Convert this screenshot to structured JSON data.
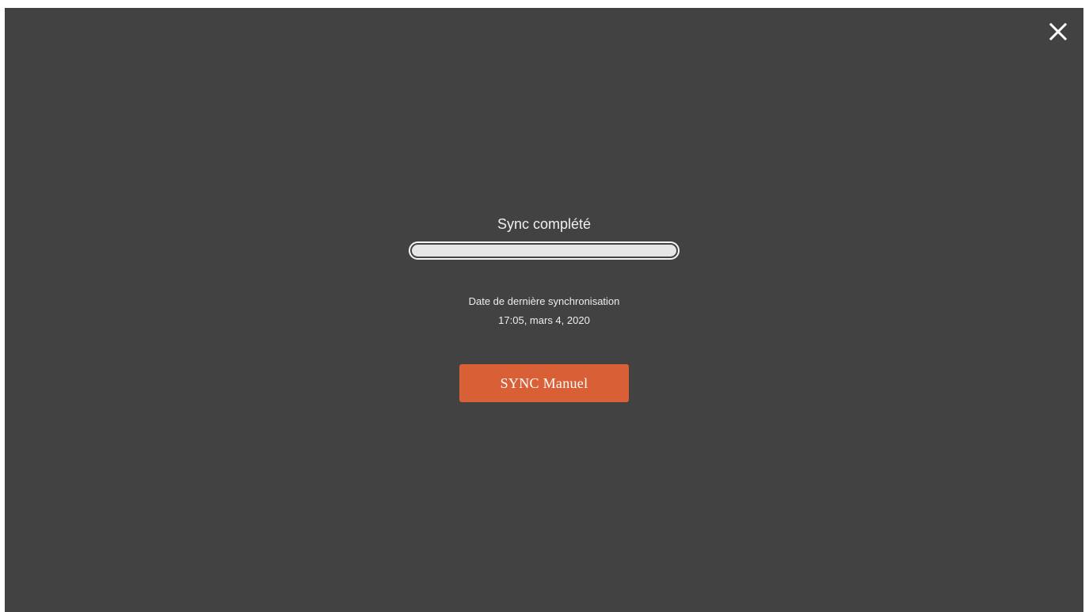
{
  "dialog": {
    "close_icon": "close-icon",
    "status_title": "Sync complété",
    "progress": {
      "value": 1.0
    },
    "last_sync_label": "Date de dernière synchronisation",
    "last_sync_value": "17:05, mars 4, 2020",
    "manual_sync_label": "SYNC Manuel"
  },
  "colors": {
    "background": "#424242",
    "button": "#d95f36",
    "progress_fill": "#e6e6e6",
    "text": "#f0f0f0"
  }
}
